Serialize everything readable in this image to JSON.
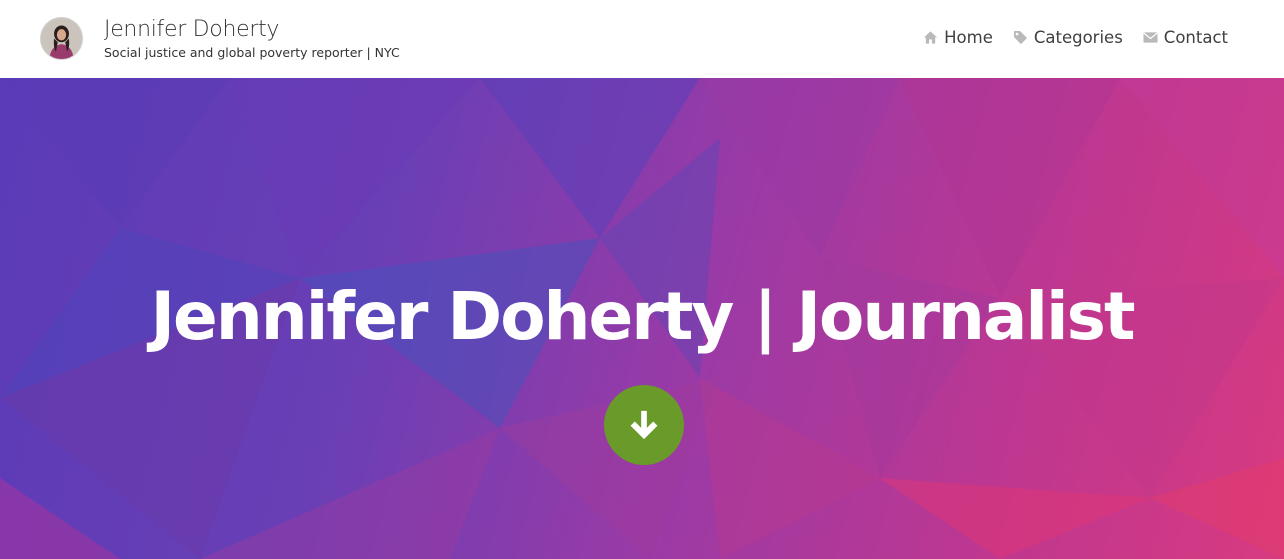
{
  "header": {
    "name": "Jennifer Doherty",
    "tagline": "Social justice and global poverty reporter | NYC",
    "avatar": "avatar-photo"
  },
  "nav": {
    "items": [
      {
        "label": "Home",
        "icon": "home-icon"
      },
      {
        "label": "Categories",
        "icon": "tag-icon"
      },
      {
        "label": "Contact",
        "icon": "envelope-icon"
      }
    ]
  },
  "hero": {
    "title": "Jennifer Doherty | Journalist",
    "scroll_button_icon": "arrow-down-icon",
    "colors": {
      "gradient_start": "#5b3bb8",
      "gradient_end": "#d83a80",
      "button": "#6a9a2a"
    }
  }
}
